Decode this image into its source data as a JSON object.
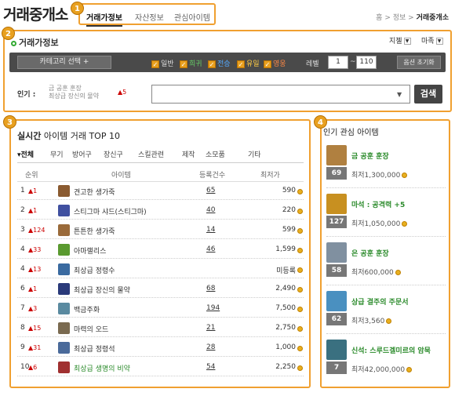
{
  "page_title": "거래중개소",
  "top_tabs": [
    "거래가정보",
    "자산정보",
    "관심아이템"
  ],
  "breadcrumb": {
    "home": "홈",
    "sep": ">",
    "mid": "정보",
    "current": "거래중개소"
  },
  "badges": [
    "1",
    "2",
    "3",
    "4"
  ],
  "search": {
    "title": "거래가정보",
    "server_select": "지젤",
    "race_select": "마족",
    "category_button": "카테고리 선택 +",
    "grades": [
      "일반",
      "희귀",
      "전승",
      "유일",
      "영웅"
    ],
    "level_label": "레벨",
    "level_min": "1",
    "level_max": "110",
    "level_sep": "~",
    "reset_button": "옵션 초기화",
    "popular_label": "인기 :",
    "popular_keywords": [
      "금 공훈 훈장",
      "최상급 장신의 물약"
    ],
    "popular_rank_change": "▲5",
    "search_button": "검색"
  },
  "ranking": {
    "title_prefix": "실시간",
    "title_main": " 아이템 거래 TOP 10",
    "categories": [
      "전체",
      "무기",
      "방어구",
      "장신구",
      "스킬관련",
      "제작",
      "소모품",
      "기타"
    ],
    "columns": {
      "rank": "순위",
      "item": "아이템",
      "count": "등록건수",
      "price": "최저가"
    },
    "rows": [
      {
        "rank": "1",
        "change": "▲1",
        "name": "견고한 생가죽",
        "count": "65",
        "price": "590",
        "green": false
      },
      {
        "rank": "2",
        "change": "▲1",
        "name": "스티그마 샤드(스티그마)",
        "count": "40",
        "price": "220",
        "green": false
      },
      {
        "rank": "3",
        "change": "▲124",
        "name": "튼튼한 생가죽",
        "count": "14",
        "price": "599",
        "green": false
      },
      {
        "rank": "4",
        "change": "▲33",
        "name": "아마랠리스",
        "count": "46",
        "price": "1,599",
        "green": false
      },
      {
        "rank": "4",
        "change": "▲13",
        "name": "최상급 정령수",
        "count": "",
        "price": "미등록",
        "green": false
      },
      {
        "rank": "6",
        "change": "▲1",
        "name": "최상급 장신의 물약",
        "count": "68",
        "price": "2,490",
        "green": false
      },
      {
        "rank": "7",
        "change": "▲3",
        "name": "백금주화",
        "count": "194",
        "price": "7,500",
        "green": false
      },
      {
        "rank": "8",
        "change": "▲15",
        "name": "마력의 오드",
        "count": "21",
        "price": "2,750",
        "green": false
      },
      {
        "rank": "9",
        "change": "▲31",
        "name": "최상급 정령석",
        "count": "28",
        "price": "1,000",
        "green": false
      },
      {
        "rank": "10",
        "change": "▲6",
        "name": "최상급 생명의 비약",
        "count": "54",
        "price": "2,250",
        "green": true
      }
    ]
  },
  "interest": {
    "title": "인기 관심 아이템",
    "items": [
      {
        "name": "금 공훈 훈장",
        "qty": "69",
        "price": "최저1,300,000",
        "color": "#b08040"
      },
      {
        "name": "마석 : 공격력 +5",
        "qty": "127",
        "price": "최저1,050,000",
        "color": "#c89020"
      },
      {
        "name": "은 공훈 훈장",
        "qty": "58",
        "price": "최저600,000",
        "color": "#8090a0"
      },
      {
        "name": "상급 결주의 주문서",
        "qty": "62",
        "price": "최저3,560",
        "color": "#4a90c0"
      },
      {
        "name": "신석: 스루드겔미르의 암묵",
        "qty": "7",
        "price": "최저42,000,000",
        "color": "#3a7080"
      }
    ]
  }
}
